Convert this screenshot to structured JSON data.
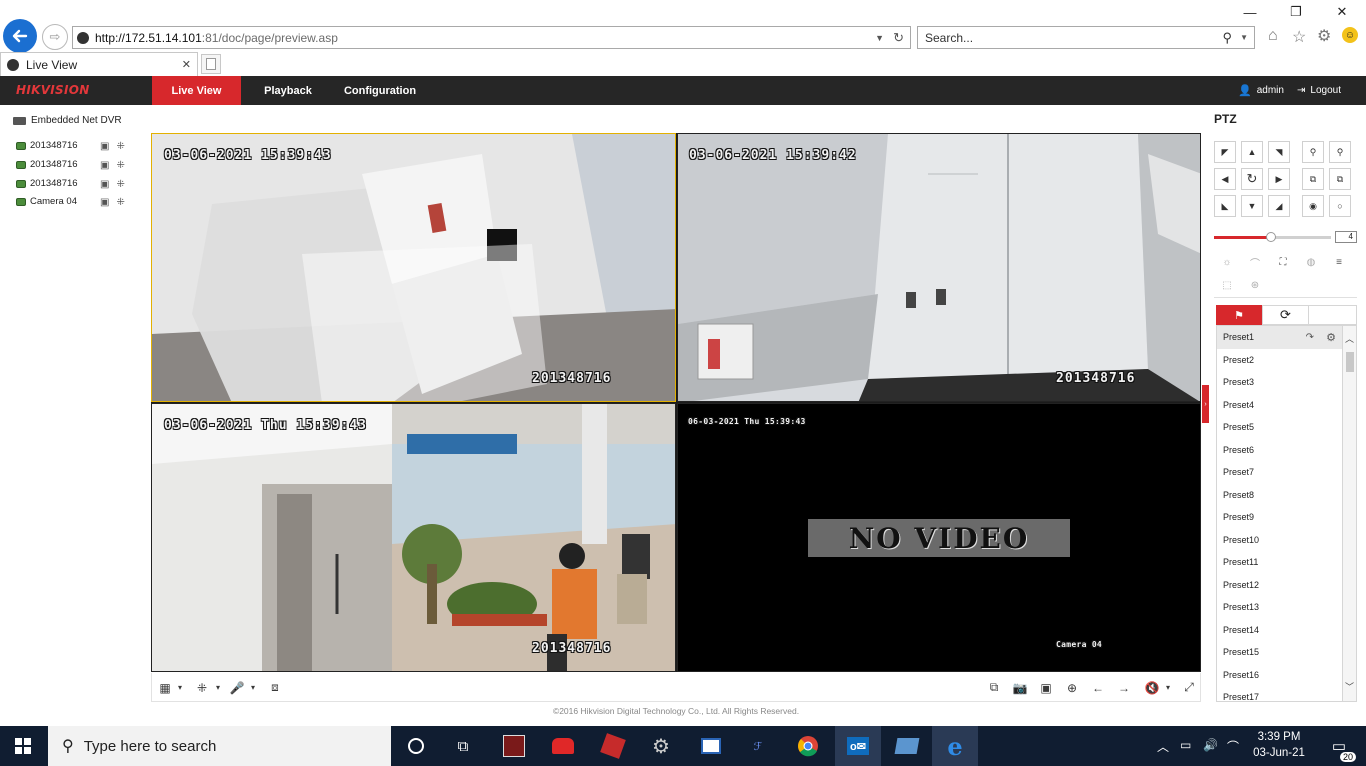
{
  "browser": {
    "url_host": "http://172.51.14.101",
    "url_path": ":81/doc/page/preview.asp",
    "search_placeholder": "Search...",
    "tab_title": "Live View",
    "minimize": "—",
    "maximize": "❐",
    "close": "✕"
  },
  "header": {
    "logo": "HIKVISION",
    "tabs": [
      {
        "label": "Live View"
      },
      {
        "label": "Playback"
      },
      {
        "label": "Configuration"
      }
    ],
    "user": "admin",
    "logout": "Logout"
  },
  "device_tree": {
    "root": "Embedded Net DVR",
    "cameras": [
      {
        "name": "201348716"
      },
      {
        "name": "201348716"
      },
      {
        "name": "201348716"
      },
      {
        "name": "Camera 04"
      }
    ]
  },
  "video": {
    "windows": [
      {
        "timestamp": "03-06-2021 15:39:43",
        "label": "201348716"
      },
      {
        "timestamp": "03-06-2021 15:39:42",
        "label": "201348716"
      },
      {
        "timestamp": "03-06-2021 Thu 15:39:43",
        "label": "201348716"
      },
      {
        "timestamp": "06-03-2021 Thu 15:39:43",
        "label": "Camera 04",
        "no_video": "NO VIDEO"
      }
    ]
  },
  "footer": {
    "copyright": "©2016 Hikvision Digital Technology Co., Ltd. All Rights Reserved."
  },
  "ptz": {
    "title": "PTZ",
    "speed": "4",
    "speed_level_fraction": 0.5,
    "presets": [
      "Preset1",
      "Preset2",
      "Preset3",
      "Preset4",
      "Preset5",
      "Preset6",
      "Preset7",
      "Preset8",
      "Preset9",
      "Preset10",
      "Preset11",
      "Preset12",
      "Preset13",
      "Preset14",
      "Preset15",
      "Preset16",
      "Preset17"
    ]
  },
  "taskbar": {
    "search_placeholder": "Type here to search",
    "time": "3:39 PM",
    "date": "03-Jun-21",
    "notifications": "20"
  },
  "colors": {
    "accent": "#d7282c",
    "header_bg": "#262626",
    "selected_border": "#e3b100",
    "taskbar_bg": "#101d31"
  }
}
